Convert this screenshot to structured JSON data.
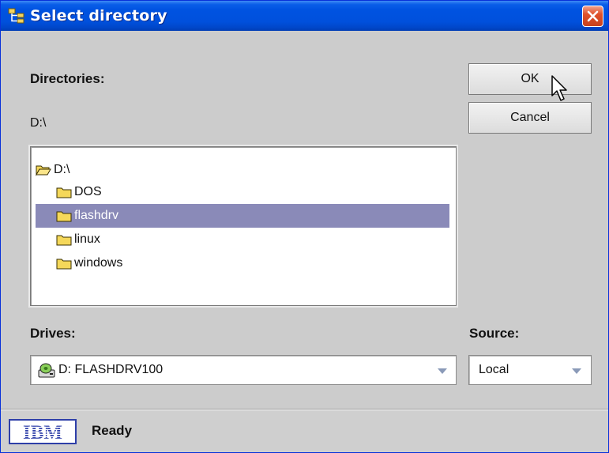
{
  "window": {
    "title": "Select directory",
    "title_icon": "directory-tree-icon",
    "close_icon": "close-icon"
  },
  "directories": {
    "label": "Directories:",
    "current_path": "D:\\",
    "tree": [
      {
        "name": "D:\\",
        "icon": "open-folder-icon",
        "level": 0,
        "selected": false
      },
      {
        "name": "DOS",
        "icon": "folder-icon",
        "level": 1,
        "selected": false
      },
      {
        "name": "flashdrv",
        "icon": "folder-icon",
        "level": 1,
        "selected": true
      },
      {
        "name": "linux",
        "icon": "folder-icon",
        "level": 1,
        "selected": false
      },
      {
        "name": "windows",
        "icon": "folder-icon",
        "level": 1,
        "selected": false
      }
    ]
  },
  "buttons": {
    "ok": "OK",
    "cancel": "Cancel"
  },
  "drives": {
    "label": "Drives:",
    "selected": "D:  FLASHDRV100",
    "icon": "drive-icon"
  },
  "source": {
    "label": "Source:",
    "selected": "Local"
  },
  "status": {
    "logo": "IBM",
    "text": "Ready"
  },
  "colors": {
    "titlebar": "#0053e1",
    "selection": "#8a8ab8",
    "folder": "#f5d85a",
    "ibm_blue": "#2e3fa8"
  }
}
